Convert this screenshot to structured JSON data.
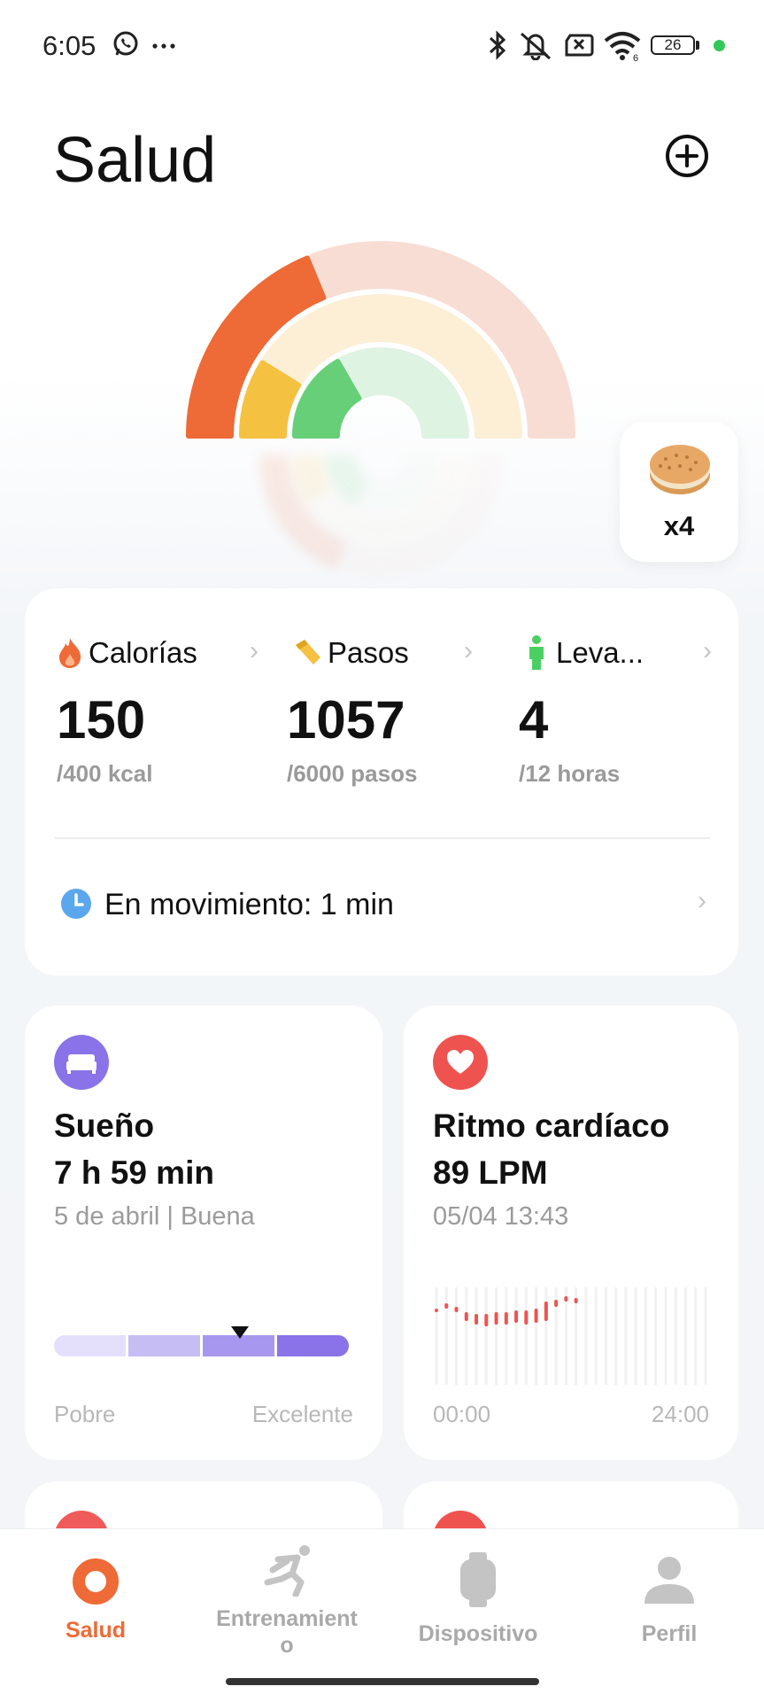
{
  "status_bar": {
    "time": "6:05",
    "left_icons": [
      "whatsapp-icon",
      "more-icon"
    ],
    "right_icons": [
      "bluetooth-icon",
      "mute-icon",
      "no-sim-icon",
      "wifi-icon"
    ],
    "battery": "26"
  },
  "header": {
    "title": "Salud",
    "add_icon": "plus-circle-icon"
  },
  "rings": {
    "calories_progress": 0.375,
    "steps_progress": 0.176,
    "stand_progress": 0.333
  },
  "badge": {
    "icon": "cookie-icon",
    "count": "x4"
  },
  "activity": {
    "metrics": [
      {
        "label": "Calorías",
        "value": "150",
        "goal": "/400 kcal",
        "icon": "flame-icon",
        "color": "#ee6a36"
      },
      {
        "label": "Pasos",
        "value": "1057",
        "goal": "/6000 pasos",
        "icon": "shoe-icon",
        "color": "#f4c140"
      },
      {
        "label": "Leva...",
        "value": "4",
        "goal": "/12 horas",
        "icon": "person-standing-icon",
        "color": "#4ccf62"
      }
    ],
    "movement": "En movimiento: 1 min"
  },
  "sleep": {
    "title": "Sueño",
    "value": "7 h 59 min",
    "subtitle": "5 de abril | Buena",
    "scale_min": "Pobre",
    "scale_max": "Excelente",
    "level": 0.63,
    "icon": "bed-icon",
    "color": "#8a73e8"
  },
  "heart": {
    "title": "Ritmo cardíaco",
    "value": "89 LPM",
    "subtitle": "05/04 13:43",
    "x_start": "00:00",
    "x_end": "24:00",
    "icon": "heart-icon",
    "color": "#ef5350"
  },
  "nav": {
    "items": [
      {
        "label": "Salud",
        "icon": "health-ring-icon",
        "active": true
      },
      {
        "label": "Entrenamient\no",
        "icon": "running-icon",
        "active": false
      },
      {
        "label": "Dispositivo",
        "icon": "watch-icon",
        "active": false
      },
      {
        "label": "Perfil",
        "icon": "profile-icon",
        "active": false
      }
    ]
  }
}
